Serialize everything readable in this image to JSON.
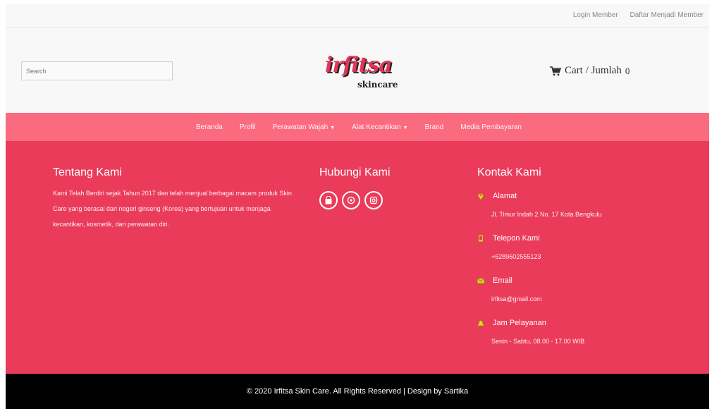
{
  "topbar": {
    "login": "Login Member",
    "register": "Daftar Menjadi Member"
  },
  "header": {
    "search_placeholder": "Search",
    "logo_script": "irfitsa",
    "logo_sub": "skincare",
    "cart_label": "Cart / Jumlah",
    "cart_count": "0"
  },
  "nav": {
    "beranda": "Beranda",
    "profil": "Profil",
    "perawatan": "Perawatan Wajah",
    "alat": "Alat Kecantikan",
    "brand": "Brand",
    "media": "Media Pembayaran"
  },
  "footer": {
    "about_title": "Tentang Kami",
    "about_text": "Kami Telah Berdiri sejak Tahun 2017 dan telah menjual berbagai macam produk Skin Care yang berasal dari negeri ginseng (Korea) yang bertujuan untuk menjaga kecantikan, kosmetik, dan perawatan diri.",
    "hubungi_title": "Hubungi Kami",
    "kontak_title": "Kontak Kami",
    "alamat_label": "Alamat",
    "alamat_value": "Jl. Timur Indah 2 No. 17 Kota Bengkulu",
    "telepon_label": "Telepon Kami",
    "telepon_value": "+6289602555123",
    "email_label": "Email",
    "email_value": "irfitsa@gmail.com",
    "jam_label": "Jam Pelayanan",
    "jam_value": "Senin - Sabtu, 08.00 - 17.00 WIB",
    "icon_color": "#b8f000"
  },
  "copyright": "© 2020 Irfitsa Skin Care. All Rights Reserved | Design by Sartika"
}
